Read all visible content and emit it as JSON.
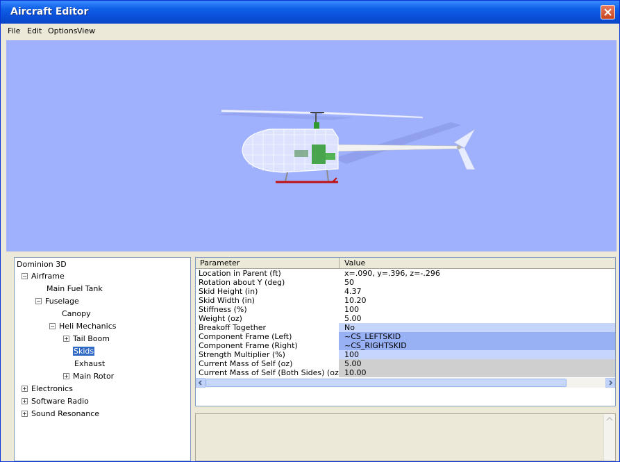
{
  "window": {
    "title": "Aircraft Editor"
  },
  "menu": [
    {
      "label": "File"
    },
    {
      "label": "Edit"
    },
    {
      "label": "Options"
    },
    {
      "label": "View"
    }
  ],
  "tree": {
    "root": "Dominion 3D",
    "nodes": [
      {
        "label": "Airframe",
        "expander": "−"
      },
      {
        "label": "Main Fuel Tank"
      },
      {
        "label": "Fuselage",
        "expander": "−"
      },
      {
        "label": "Canopy"
      },
      {
        "label": "Heli Mechanics",
        "expander": "−"
      },
      {
        "label": "Tail Boom",
        "expander": "+"
      },
      {
        "label": "Skids",
        "selected": true
      },
      {
        "label": "Exhaust"
      },
      {
        "label": "Main Rotor",
        "expander": "+"
      },
      {
        "label": "Electronics",
        "expander": "+"
      },
      {
        "label": "Software Radio",
        "expander": "+"
      },
      {
        "label": "Sound Resonance",
        "expander": "+"
      }
    ]
  },
  "grid": {
    "headers": {
      "parameter": "Parameter",
      "value": "Value"
    },
    "rows": [
      {
        "parameter": "Location in Parent (ft)",
        "value": "x=.090, y=.396, z=-.296"
      },
      {
        "parameter": "Rotation about Y (deg)",
        "value": "50"
      },
      {
        "parameter": "Skid Height (in)",
        "value": "4.37"
      },
      {
        "parameter": "Skid Width (in)",
        "value": "10.20"
      },
      {
        "parameter": "Stiffness (%)",
        "value": "100"
      },
      {
        "parameter": "Weight (oz)",
        "value": "5.00"
      },
      {
        "parameter": "Breakoff Together",
        "value": "No"
      },
      {
        "parameter": "Component Frame (Left)",
        "value": "~CS_LEFTSKID"
      },
      {
        "parameter": "Component Frame (Right)",
        "value": "~CS_RIGHTSKID"
      },
      {
        "parameter": "Strength Multiplier (%)",
        "value": "100"
      },
      {
        "parameter": "Current Mass of Self (oz)",
        "value": "5.00"
      },
      {
        "parameter": "Current Mass of Self (Both Sides) (oz)",
        "value": "10.00"
      }
    ]
  },
  "colors": {
    "viewport_bg": "#9fb0fd",
    "titlebar": "#0a4fd8",
    "selection": "#316ac5",
    "skid": "#c01010"
  }
}
